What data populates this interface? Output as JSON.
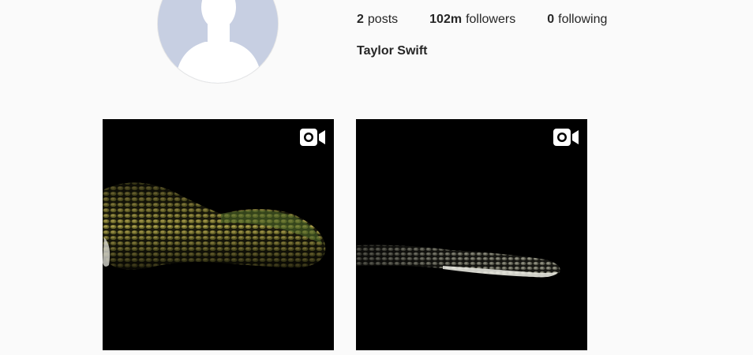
{
  "profile": {
    "full_name": "Taylor Swift",
    "avatar_icon": "default-avatar-icon",
    "avatar_color": "#c7cfe2"
  },
  "stats": {
    "posts": {
      "count": "2",
      "label": "posts"
    },
    "followers": {
      "count": "102m",
      "label": "followers"
    },
    "following": {
      "count": "0",
      "label": "following"
    }
  },
  "posts": [
    {
      "type": "video",
      "badge_icon": "video-camera-icon",
      "description_icon": "snake-scales-image"
    },
    {
      "type": "video",
      "badge_icon": "video-camera-icon",
      "description_icon": "snake-tail-image"
    }
  ],
  "colors": {
    "background": "#fafafa",
    "text": "#262626",
    "post_background": "#000000"
  }
}
